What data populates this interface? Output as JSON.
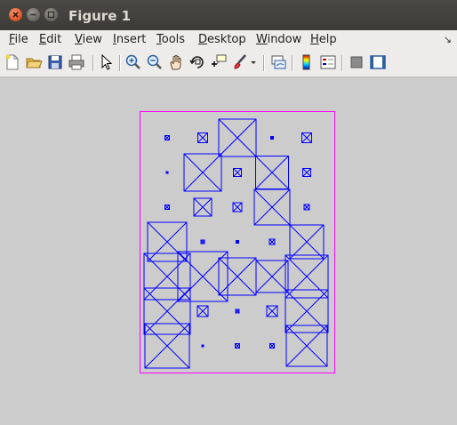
{
  "window": {
    "title": "Figure 1"
  },
  "menu": [
    {
      "label": "File",
      "mnemonic": "F"
    },
    {
      "label": "Edit",
      "mnemonic": "E"
    },
    {
      "label": "View",
      "mnemonic": "V"
    },
    {
      "label": "Insert",
      "mnemonic": "I"
    },
    {
      "label": "Tools",
      "mnemonic": "T"
    },
    {
      "label": "Desktop",
      "mnemonic": "D"
    },
    {
      "label": "Window",
      "mnemonic": "W"
    },
    {
      "label": "Help",
      "mnemonic": "H"
    }
  ],
  "toolbar": {
    "icons": [
      "new-figure-icon",
      "open-file-icon",
      "save-icon",
      "print-icon",
      "select-arrow-icon",
      "zoom-in-icon",
      "zoom-out-icon",
      "pan-hand-icon",
      "rotate-3d-icon",
      "data-cursor-icon",
      "brush-icon",
      "brush-dropdown-icon",
      "link-plot-icon",
      "colorbar-icon",
      "legend-icon",
      "hide-plot-tools-icon",
      "show-plot-tools-icon"
    ]
  },
  "colors": {
    "box": "#0000ff",
    "frame": "#ff00ff",
    "background": "#cccccc"
  }
}
